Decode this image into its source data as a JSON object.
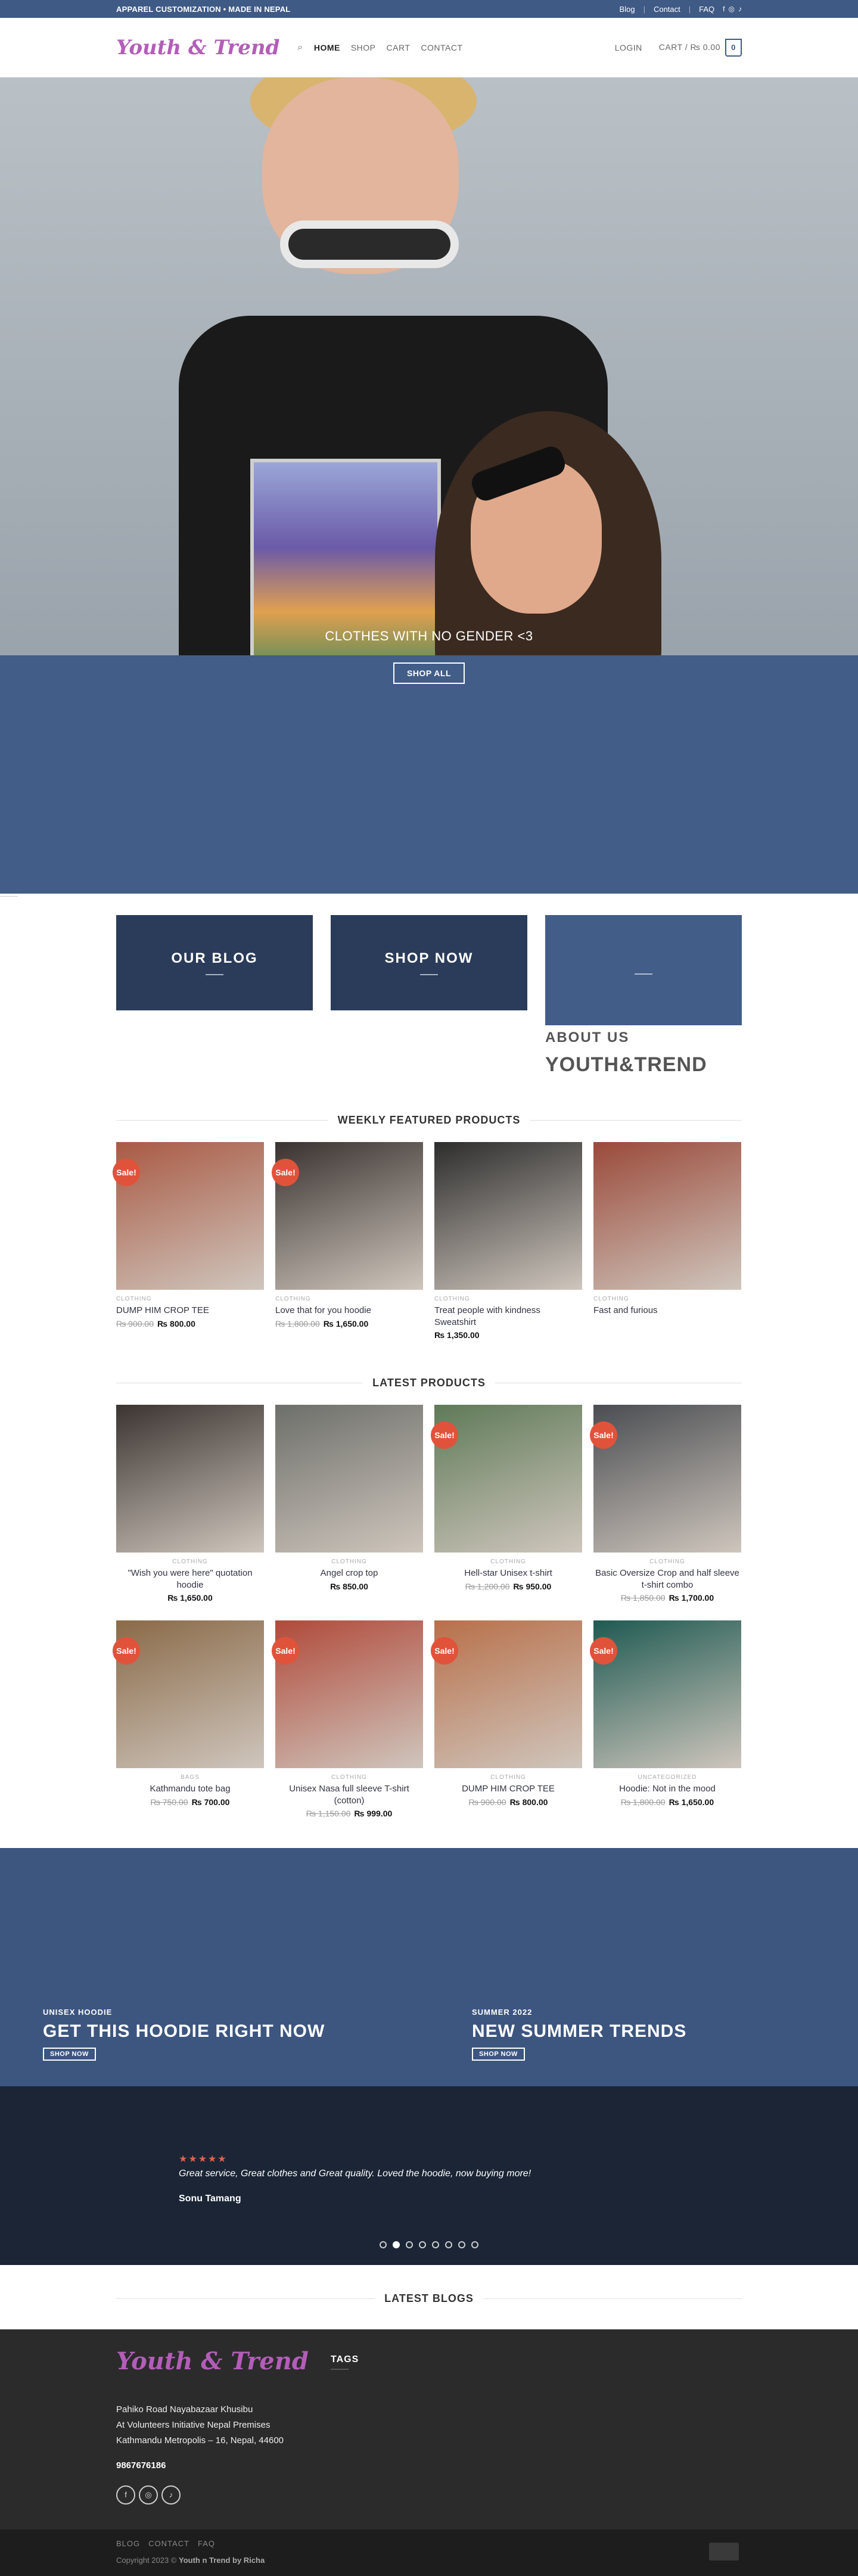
{
  "topbar": {
    "promo": "APPAREL CUSTOMIZATION • MADE IN NEPAL",
    "links": [
      "Blog",
      "Contact",
      "FAQ"
    ]
  },
  "header": {
    "logo": "Youth & Trend",
    "nav": [
      "HOME",
      "SHOP",
      "CART",
      "CONTACT"
    ],
    "login": "LOGIN",
    "cart": "CART / ₨ 0.00",
    "cart_count": "0"
  },
  "hero": {
    "caption": "CLOTHES WITH NO GENDER <3",
    "button": "SHOP ALL"
  },
  "banners": {
    "blog": "OUR BLOG",
    "shop": "SHOP NOW",
    "about_sub": "ABOUT US",
    "about_title": "YOUTH&TREND"
  },
  "featured": {
    "title": "WEEKLY FEATURED PRODUCTS",
    "items": [
      {
        "cat": "CLOTHING",
        "name": "DUMP HIM CROP TEE",
        "old": "₨ 900.00",
        "price": "₨ 800.00",
        "sale": true
      },
      {
        "cat": "CLOTHING",
        "name": "Love that for you hoodie",
        "old": "₨ 1,800.00",
        "price": "₨ 1,650.00",
        "sale": true
      },
      {
        "cat": "CLOTHING",
        "name": "Treat people with kindness Sweatshirt",
        "old": "",
        "price": "₨ 1,350.00",
        "sale": false
      },
      {
        "cat": "CLOTHING",
        "name": "Fast and furious",
        "old": "",
        "price": "",
        "sale": false
      }
    ]
  },
  "latest": {
    "title": "LATEST PRODUCTS",
    "items": [
      {
        "cat": "CLOTHING",
        "name": "\"Wish you were here\" quotation hoodie",
        "old": "",
        "price": "₨ 1,650.00",
        "sale": false
      },
      {
        "cat": "CLOTHING",
        "name": "Angel crop top",
        "old": "",
        "price": "₨ 850.00",
        "sale": false
      },
      {
        "cat": "CLOTHING",
        "name": "Hell-star Unisex t-shirt",
        "old": "₨ 1,200.00",
        "price": "₨ 950.00",
        "sale": true
      },
      {
        "cat": "CLOTHING",
        "name": "Basic Oversize Crop and half sleeve t-shirt combo",
        "old": "₨ 1,850.00",
        "price": "₨ 1,700.00",
        "sale": true
      },
      {
        "cat": "BAGS",
        "name": "Kathmandu tote bag",
        "old": "₨ 750.00",
        "price": "₨ 700.00",
        "sale": true
      },
      {
        "cat": "CLOTHING",
        "name": "Unisex Nasa full sleeve T-shirt (cotton)",
        "old": "₨ 1,150.00",
        "price": "₨ 999.00",
        "sale": true
      },
      {
        "cat": "CLOTHING",
        "name": "DUMP HIM CROP TEE",
        "old": "₨ 900.00",
        "price": "₨ 800.00",
        "sale": true
      },
      {
        "cat": "UNCATEGORIZED",
        "name": "Hoodie: Not in the mood",
        "old": "₨ 1,800.00",
        "price": "₨ 1,650.00",
        "sale": true
      }
    ]
  },
  "promos": [
    {
      "small": "UNISEX HOODIE",
      "big": "GET THIS HOODIE RIGHT NOW",
      "btn": "SHOP NOW"
    },
    {
      "small": "SUMMER 2022",
      "big": "NEW SUMMER TRENDS",
      "btn": "SHOP NOW"
    }
  ],
  "testimonial": {
    "stars": "★★★★★",
    "quote": "Great service, Great clothes and Great quality. Loved the hoodie, now buying more!",
    "author": "Sonu Tamang"
  },
  "latest_blogs": "LATEST BLOGS",
  "footer": {
    "logo": "Youth & Trend",
    "address": [
      "Pahiko Road Nayabazaar Khusibu",
      "At Volunteers Initiative Nepal Premises",
      "Kathmandu Metropolis – 16, Nepal, 44600"
    ],
    "phone": "9867676186",
    "tags_title": "TAGS",
    "bottom_links": [
      "BLOG",
      "CONTACT",
      "FAQ"
    ],
    "copyright_prefix": "Copyright 2023 ©",
    "copyright_name": "Youth n Trend by Richa"
  },
  "sale_label": "Sale!"
}
